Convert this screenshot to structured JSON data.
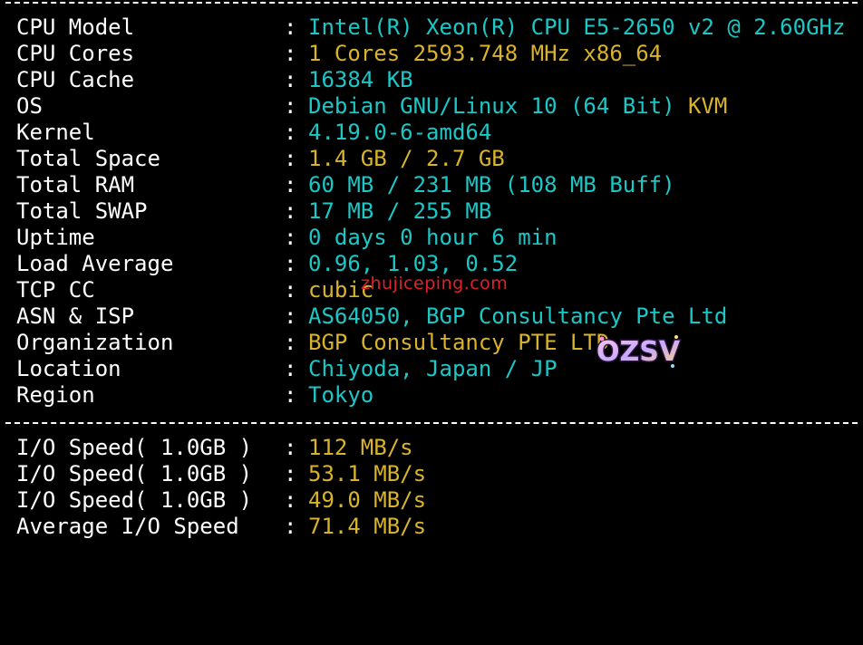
{
  "system_info": [
    {
      "label": "CPU Model",
      "value": "Intel(R) Xeon(R) CPU E5-2650 v2 @ 2.60GHz",
      "suffix": ""
    },
    {
      "label": "CPU Cores",
      "value": "1 Cores 2593.748 MHz x86_64",
      "suffix": ""
    },
    {
      "label": "CPU Cache",
      "value": "16384 KB",
      "suffix": ""
    },
    {
      "label": "OS",
      "value": "Debian GNU/Linux 10 (64 Bit) ",
      "suffix": "KVM"
    },
    {
      "label": "Kernel",
      "value": "4.19.0-6-amd64",
      "suffix": ""
    },
    {
      "label": "Total Space",
      "value": "1.4 GB / 2.7 GB",
      "suffix": ""
    },
    {
      "label": "Total RAM",
      "value": "60 MB / 231 MB (108 MB Buff)",
      "suffix": ""
    },
    {
      "label": "Total SWAP",
      "value": "17 MB / 255 MB",
      "suffix": ""
    },
    {
      "label": "Uptime",
      "value": "0 days 0 hour 6 min",
      "suffix": ""
    },
    {
      "label": "Load Average",
      "value": "0.96, 1.03, 0.52",
      "suffix": ""
    },
    {
      "label": "TCP CC",
      "value": "cubic",
      "suffix": ""
    },
    {
      "label": "ASN & ISP",
      "value": "AS64050, BGP Consultancy Pte Ltd",
      "suffix": ""
    },
    {
      "label": "Organization",
      "value": "BGP Consultancy PTE LTD",
      "suffix": ""
    },
    {
      "label": "Location",
      "value": "Chiyoda, Japan / JP",
      "suffix": ""
    },
    {
      "label": "Region",
      "value": "Tokyo",
      "suffix": ""
    }
  ],
  "io_info": [
    {
      "label": "I/O Speed( 1.0GB )",
      "value": "112 MB/s"
    },
    {
      "label": "I/O Speed( 1.0GB )",
      "value": "53.1 MB/s"
    },
    {
      "label": "I/O Speed( 1.0GB )",
      "value": "49.0 MB/s"
    },
    {
      "label": "Average I/O Speed",
      "value": "71.4 MB/s"
    }
  ],
  "separator": ":",
  "watermark": {
    "site": "zhujiceping.com",
    "logo": "OZSV",
    "logo_icon": "ozsv-logo-icon"
  },
  "colors": {
    "background": "#000000",
    "label": "#ffffff",
    "value_teal": "#1cc7c7",
    "value_gold": "#d9b42a",
    "watermark": "#e0202a"
  }
}
